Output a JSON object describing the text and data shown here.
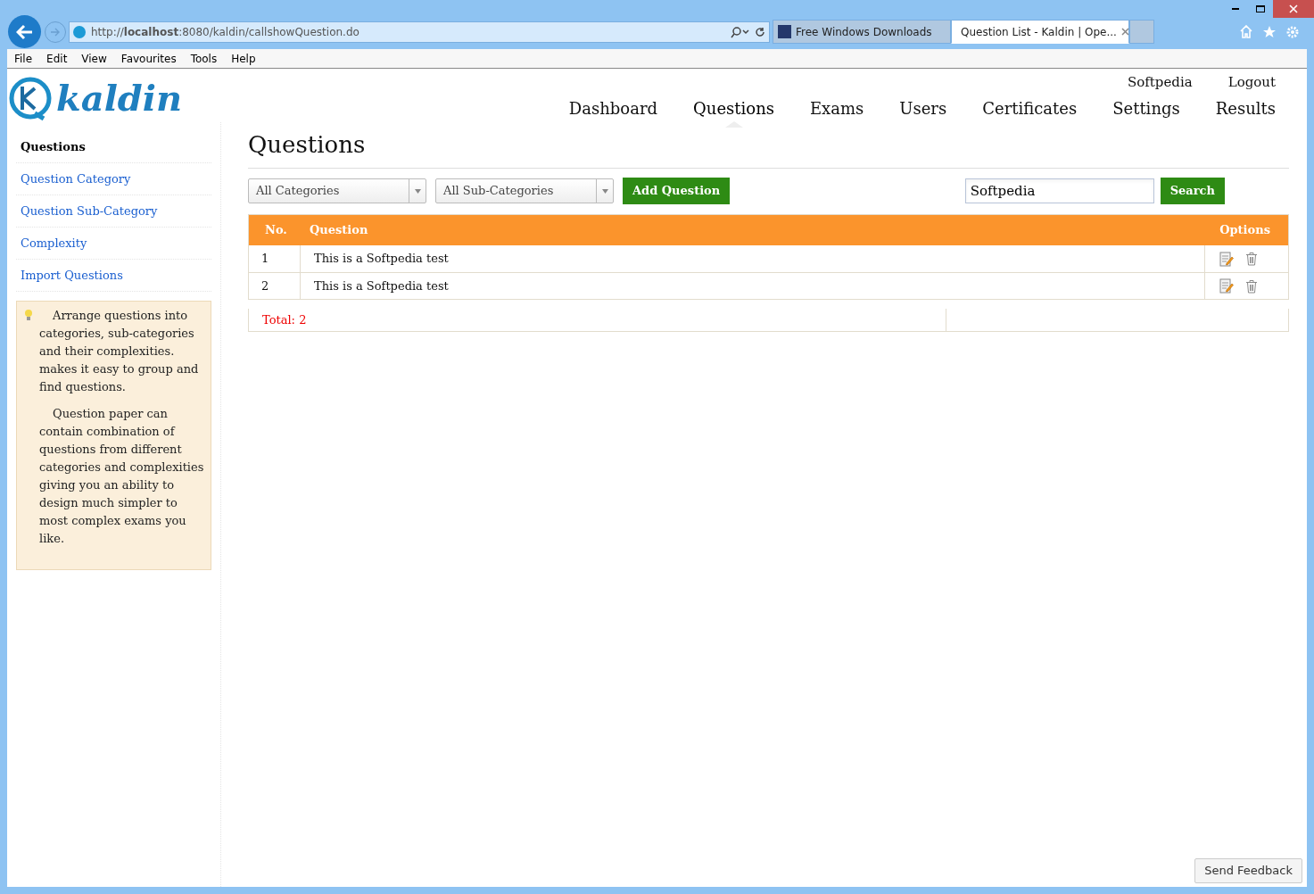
{
  "browser": {
    "url": "http://**localhost**:8080/kaldin/callshowQuestion.do",
    "tabs": [
      {
        "title": "Free Windows Downloads",
        "selected": false,
        "kind": "s"
      },
      {
        "title": "Question List - Kaldin | Ope...",
        "selected": true,
        "kind": "k"
      }
    ],
    "menu": [
      "File",
      "Edit",
      "View",
      "Favourites",
      "Tools",
      "Help"
    ]
  },
  "header": {
    "logo": "kaldin",
    "user_links": [
      "Softpedia",
      "Logout"
    ],
    "nav": [
      {
        "label": "Dashboard",
        "selected": false
      },
      {
        "label": "Questions",
        "selected": true
      },
      {
        "label": "Exams",
        "selected": false
      },
      {
        "label": "Users",
        "selected": false
      },
      {
        "label": "Certificates",
        "selected": false
      },
      {
        "label": "Settings",
        "selected": false
      },
      {
        "label": "Results",
        "selected": false
      }
    ]
  },
  "sidebar": {
    "items": [
      {
        "label": "Questions",
        "selected": true
      },
      {
        "label": "Question Category",
        "selected": false
      },
      {
        "label": "Question Sub-Category",
        "selected": false
      },
      {
        "label": "Complexity",
        "selected": false
      },
      {
        "label": "Import Questions",
        "selected": false
      }
    ],
    "tip": [
      "Arrange questions into categories, sub-categories and their complexities. makes it easy to group and find questions.",
      "Question paper can contain combination of questions from different categories and complexities giving you an ability to design much simpler to most complex exams you like."
    ]
  },
  "content": {
    "title": "Questions",
    "category": "All Categories",
    "subcategory": "All Sub-Categories",
    "add_button": "Add Question",
    "search_value": "Softpedia",
    "search_button": "Search",
    "table": {
      "columns": [
        "No.",
        "Question",
        "Options"
      ],
      "rows": [
        {
          "no": "1",
          "question": "This is a Softpedia test"
        },
        {
          "no": "2",
          "question": "This is a Softpedia test"
        }
      ]
    },
    "total": "Total: 2"
  },
  "feedback_button": "Send Feedback"
}
